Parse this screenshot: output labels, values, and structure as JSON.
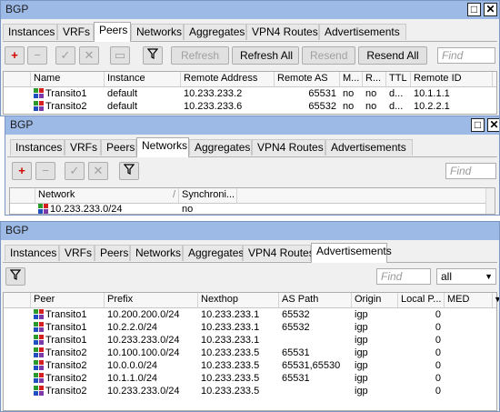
{
  "peers_window": {
    "title": "BGP",
    "tabs": [
      "Instances",
      "VRFs",
      "Peers",
      "Networks",
      "Aggregates",
      "VPN4 Routes",
      "Advertisements"
    ],
    "active_tab": "Peers",
    "toolbar": {
      "refresh": "Refresh",
      "refresh_all": "Refresh All",
      "resend": "Resend",
      "resend_all": "Resend All",
      "find_placeholder": "Find"
    },
    "columns": [
      "Name",
      "Instance",
      "Remote Address",
      "Remote AS",
      "M...",
      "R...",
      "TTL",
      "Remote ID"
    ],
    "rows": [
      {
        "name": "Transito1",
        "instance": "default",
        "remote_address": "10.233.233.2",
        "remote_as": "65531",
        "m": "no",
        "r": "no",
        "ttl": "d...",
        "remote_id": "10.1.1.1"
      },
      {
        "name": "Transito2",
        "instance": "default",
        "remote_address": "10.233.233.6",
        "remote_as": "65532",
        "m": "no",
        "r": "no",
        "ttl": "d...",
        "remote_id": "10.2.2.1"
      }
    ]
  },
  "networks_window": {
    "title": "BGP",
    "tabs": [
      "Instances",
      "VRFs",
      "Peers",
      "Networks",
      "Aggregates",
      "VPN4 Routes",
      "Advertisements"
    ],
    "active_tab": "Networks",
    "find_placeholder": "Find",
    "columns": [
      "Network",
      "Synchroni..."
    ],
    "rows": [
      {
        "network": "10.233.233.0/24",
        "sync": "no"
      }
    ]
  },
  "adv_window": {
    "title": "BGP",
    "tabs": [
      "Instances",
      "VRFs",
      "Peers",
      "Networks",
      "Aggregates",
      "VPN4 Routes",
      "Advertisements"
    ],
    "active_tab": "Advertisements",
    "find_placeholder": "Find",
    "filter_value": "all",
    "columns": [
      "Peer",
      "Prefix",
      "Nexthop",
      "AS Path",
      "Origin",
      "Local P...",
      "MED"
    ],
    "rows": [
      {
        "peer": "Transito1",
        "prefix": "10.200.200.0/24",
        "nexthop": "10.233.233.1",
        "as_path": "65532",
        "origin": "igp",
        "local_pref": "0",
        "med": ""
      },
      {
        "peer": "Transito1",
        "prefix": "10.2.2.0/24",
        "nexthop": "10.233.233.1",
        "as_path": "65532",
        "origin": "igp",
        "local_pref": "0",
        "med": ""
      },
      {
        "peer": "Transito1",
        "prefix": "10.233.233.0/24",
        "nexthop": "10.233.233.1",
        "as_path": "",
        "origin": "igp",
        "local_pref": "0",
        "med": ""
      },
      {
        "peer": "Transito2",
        "prefix": "10.100.100.0/24",
        "nexthop": "10.233.233.5",
        "as_path": "65531",
        "origin": "igp",
        "local_pref": "0",
        "med": ""
      },
      {
        "peer": "Transito2",
        "prefix": "10.0.0.0/24",
        "nexthop": "10.233.233.5",
        "as_path": "65531,65530",
        "origin": "igp",
        "local_pref": "0",
        "med": ""
      },
      {
        "peer": "Transito2",
        "prefix": "10.1.1.0/24",
        "nexthop": "10.233.233.5",
        "as_path": "65531",
        "origin": "igp",
        "local_pref": "0",
        "med": ""
      },
      {
        "peer": "Transito2",
        "prefix": "10.233.233.0/24",
        "nexthop": "10.233.233.5",
        "as_path": "",
        "origin": "igp",
        "local_pref": "0",
        "med": ""
      }
    ]
  },
  "colors": {
    "titlebar": "#9db9e6",
    "plus": "#d40000"
  }
}
